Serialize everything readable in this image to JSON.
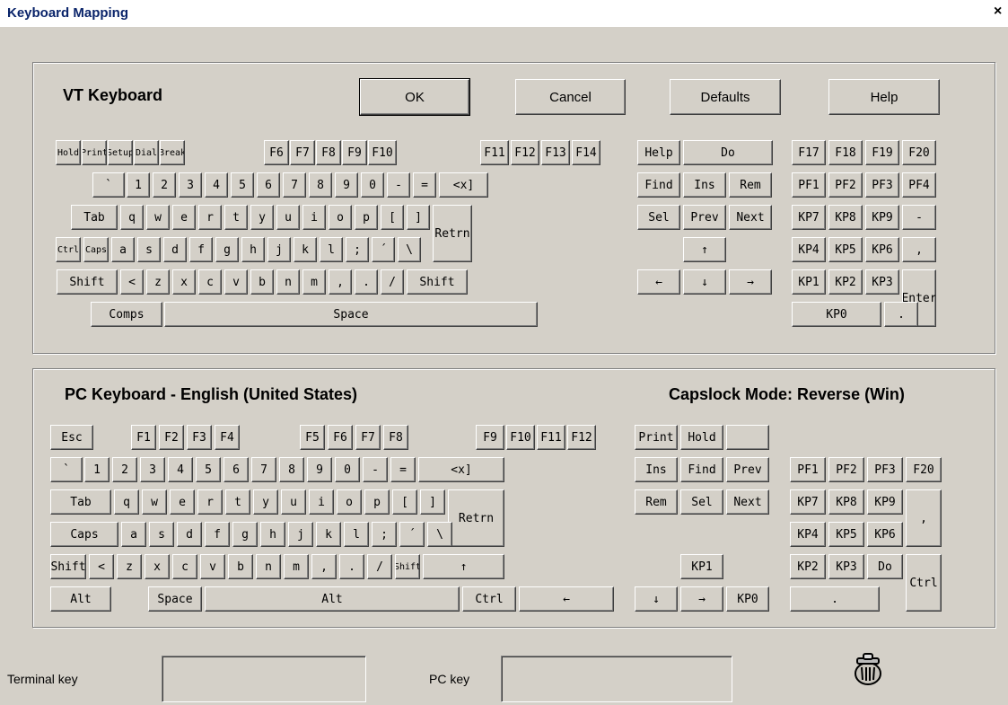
{
  "window": {
    "title": "Keyboard Mapping",
    "close": "×"
  },
  "vt": {
    "title": "VT Keyboard",
    "buttons": {
      "ok": "OK",
      "cancel": "Cancel",
      "defaults": "Defaults",
      "help": "Help"
    }
  },
  "pc": {
    "title": "PC Keyboard - English (United States)",
    "capslock": "Capslock Mode: Reverse (Win)"
  },
  "footer": {
    "terminal_key": "Terminal key",
    "pc_key": "PC key"
  },
  "icons": {
    "trash": "trash-can-icon"
  },
  "vt_keys": [
    {
      "t": "Hold"
    },
    {
      "t": "Print"
    },
    {
      "t": "Setup"
    },
    {
      "t": "Dial"
    },
    {
      "t": "Break"
    },
    {
      "t": "F6"
    },
    {
      "t": "F7"
    },
    {
      "t": "F8"
    },
    {
      "t": "F9"
    },
    {
      "t": "F10"
    },
    {
      "t": "F11"
    },
    {
      "t": "F12"
    },
    {
      "t": "F13"
    },
    {
      "t": "F14"
    },
    {
      "t": "Help"
    },
    {
      "t": "Do"
    },
    {
      "t": "F17"
    },
    {
      "t": "F18"
    },
    {
      "t": "F19"
    },
    {
      "t": "F20"
    },
    {
      "t": "`"
    },
    {
      "t": "1"
    },
    {
      "t": "2"
    },
    {
      "t": "3"
    },
    {
      "t": "4"
    },
    {
      "t": "5"
    },
    {
      "t": "6"
    },
    {
      "t": "7"
    },
    {
      "t": "8"
    },
    {
      "t": "9"
    },
    {
      "t": "0"
    },
    {
      "t": "-"
    },
    {
      "t": "="
    },
    {
      "t": "<x]"
    },
    {
      "t": "Find"
    },
    {
      "t": "Ins"
    },
    {
      "t": "Rem"
    },
    {
      "t": "PF1"
    },
    {
      "t": "PF2"
    },
    {
      "t": "PF3"
    },
    {
      "t": "PF4"
    },
    {
      "t": "Tab"
    },
    {
      "t": "q"
    },
    {
      "t": "w"
    },
    {
      "t": "e"
    },
    {
      "t": "r"
    },
    {
      "t": "t"
    },
    {
      "t": "y"
    },
    {
      "t": "u"
    },
    {
      "t": "i"
    },
    {
      "t": "o"
    },
    {
      "t": "p"
    },
    {
      "t": "["
    },
    {
      "t": "]"
    },
    {
      "t": "Retrn"
    },
    {
      "t": "Sel"
    },
    {
      "t": "Prev"
    },
    {
      "t": "Next"
    },
    {
      "t": "KP7"
    },
    {
      "t": "KP8"
    },
    {
      "t": "KP9"
    },
    {
      "t": "-"
    },
    {
      "t": "Ctrl"
    },
    {
      "t": "Caps"
    },
    {
      "t": "a"
    },
    {
      "t": "s"
    },
    {
      "t": "d"
    },
    {
      "t": "f"
    },
    {
      "t": "g"
    },
    {
      "t": "h"
    },
    {
      "t": "j"
    },
    {
      "t": "k"
    },
    {
      "t": "l"
    },
    {
      "t": ";"
    },
    {
      "t": "´"
    },
    {
      "t": "\\"
    },
    {
      "t": "↑"
    },
    {
      "t": "KP4"
    },
    {
      "t": "KP5"
    },
    {
      "t": "KP6"
    },
    {
      "t": ","
    },
    {
      "t": "Shift"
    },
    {
      "t": "<"
    },
    {
      "t": "z"
    },
    {
      "t": "x"
    },
    {
      "t": "c"
    },
    {
      "t": "v"
    },
    {
      "t": "b"
    },
    {
      "t": "n"
    },
    {
      "t": "m"
    },
    {
      "t": ","
    },
    {
      "t": "."
    },
    {
      "t": "/"
    },
    {
      "t": "Shift"
    },
    {
      "t": "←"
    },
    {
      "t": "↓"
    },
    {
      "t": "→"
    },
    {
      "t": "KP1"
    },
    {
      "t": "KP2"
    },
    {
      "t": "KP3"
    },
    {
      "t": "Enter"
    },
    {
      "t": "Comps"
    },
    {
      "t": "Space"
    },
    {
      "t": "KP0"
    },
    {
      "t": "."
    }
  ],
  "pc_keys": [
    {
      "t": "Esc"
    },
    {
      "t": "F1"
    },
    {
      "t": "F2"
    },
    {
      "t": "F3"
    },
    {
      "t": "F4"
    },
    {
      "t": "F5"
    },
    {
      "t": "F6"
    },
    {
      "t": "F7"
    },
    {
      "t": "F8"
    },
    {
      "t": "F9"
    },
    {
      "t": "F10"
    },
    {
      "t": "F11"
    },
    {
      "t": "F12"
    },
    {
      "t": "Print"
    },
    {
      "t": "Hold"
    },
    {
      "t": ""
    },
    {
      "t": "`"
    },
    {
      "t": "1"
    },
    {
      "t": "2"
    },
    {
      "t": "3"
    },
    {
      "t": "4"
    },
    {
      "t": "5"
    },
    {
      "t": "6"
    },
    {
      "t": "7"
    },
    {
      "t": "8"
    },
    {
      "t": "9"
    },
    {
      "t": "0"
    },
    {
      "t": "-"
    },
    {
      "t": "="
    },
    {
      "t": "<x]"
    },
    {
      "t": "Ins"
    },
    {
      "t": "Find"
    },
    {
      "t": "Prev"
    },
    {
      "t": "PF1"
    },
    {
      "t": "PF2"
    },
    {
      "t": "PF3"
    },
    {
      "t": "F20"
    },
    {
      "t": "Tab"
    },
    {
      "t": "q"
    },
    {
      "t": "w"
    },
    {
      "t": "e"
    },
    {
      "t": "r"
    },
    {
      "t": "t"
    },
    {
      "t": "y"
    },
    {
      "t": "u"
    },
    {
      "t": "i"
    },
    {
      "t": "o"
    },
    {
      "t": "p"
    },
    {
      "t": "["
    },
    {
      "t": "]"
    },
    {
      "t": "Retrn"
    },
    {
      "t": "Rem"
    },
    {
      "t": "Sel"
    },
    {
      "t": "Next"
    },
    {
      "t": "KP7"
    },
    {
      "t": "KP8"
    },
    {
      "t": "KP9"
    },
    {
      "t": ","
    },
    {
      "t": "Caps"
    },
    {
      "t": "a"
    },
    {
      "t": "s"
    },
    {
      "t": "d"
    },
    {
      "t": "f"
    },
    {
      "t": "g"
    },
    {
      "t": "h"
    },
    {
      "t": "j"
    },
    {
      "t": "k"
    },
    {
      "t": "l"
    },
    {
      "t": ";"
    },
    {
      "t": "´"
    },
    {
      "t": "\\"
    },
    {
      "t": "KP4"
    },
    {
      "t": "KP5"
    },
    {
      "t": "KP6"
    },
    {
      "t": "Shift"
    },
    {
      "t": "<"
    },
    {
      "t": "z"
    },
    {
      "t": "x"
    },
    {
      "t": "c"
    },
    {
      "t": "v"
    },
    {
      "t": "b"
    },
    {
      "t": "n"
    },
    {
      "t": "m"
    },
    {
      "t": ","
    },
    {
      "t": "."
    },
    {
      "t": "/"
    },
    {
      "t": "Shift"
    },
    {
      "t": "↑"
    },
    {
      "t": "KP1"
    },
    {
      "t": "KP2"
    },
    {
      "t": "KP3"
    },
    {
      "t": "Do"
    },
    {
      "t": "Ctrl"
    },
    {
      "t": "Alt"
    },
    {
      "t": "Space"
    },
    {
      "t": "Alt"
    },
    {
      "t": "Ctrl"
    },
    {
      "t": "←"
    },
    {
      "t": "↓"
    },
    {
      "t": "→"
    },
    {
      "t": "KP0"
    },
    {
      "t": "."
    }
  ]
}
